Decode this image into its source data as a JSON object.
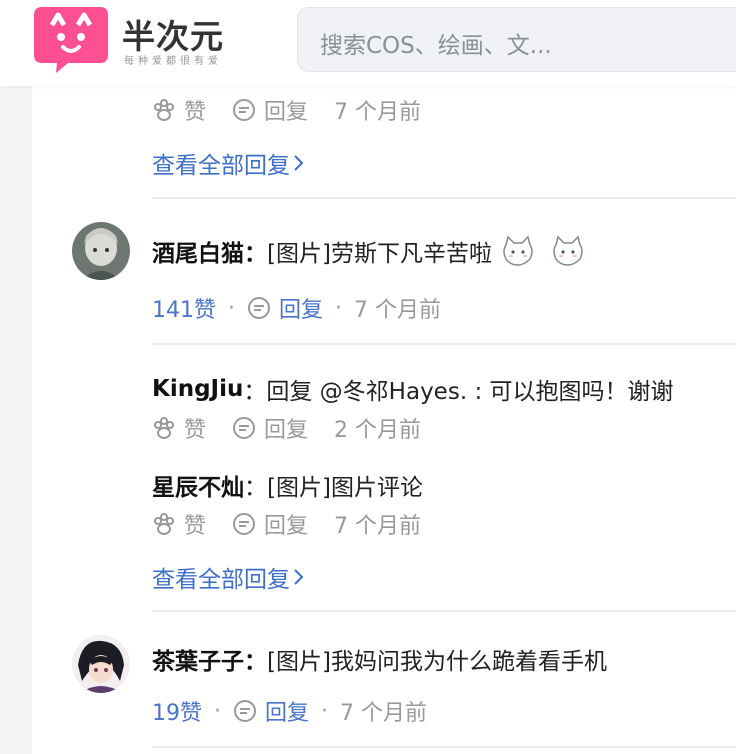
{
  "header": {
    "logo_text": "半次元",
    "logo_sub": "每种爱都很有爱",
    "search_placeholder": "搜索COS、绘画、文..."
  },
  "comments": [
    {
      "top_actions": {
        "like": "赞",
        "reply": "回复",
        "time": "7 个月前"
      },
      "view_all": "查看全部回复"
    },
    {
      "author": "酒尾白猫",
      "separator": "：",
      "text": "[图片]劳斯下凡辛苦啦",
      "likes": "141赞",
      "reply": "回复",
      "time": "7 个月前",
      "replies": [
        {
          "author": "KingJiu",
          "separator": "：",
          "text": "回复 @冬祁Hayes. : 可以抱图吗！谢谢",
          "like": "赞",
          "reply": "回复",
          "time": "2 个月前"
        },
        {
          "author": "星辰不灿",
          "separator": "：",
          "text": "[图片]图片评论",
          "like": "赞",
          "reply": "回复",
          "time": "7 个月前"
        }
      ],
      "view_all": "查看全部回复"
    },
    {
      "author": "茶葉子子",
      "separator": "：",
      "text": "[图片]我妈问我为什么跪着看手机",
      "likes": "19赞",
      "reply": "回复",
      "time": "7 个月前"
    }
  ],
  "icons": [
    "paw-icon",
    "comment-icon",
    "chevron-right-icon",
    "search-icon"
  ],
  "colors": {
    "brand": "#ff4f93",
    "link": "#3f6fc6",
    "meta": "#999999"
  }
}
